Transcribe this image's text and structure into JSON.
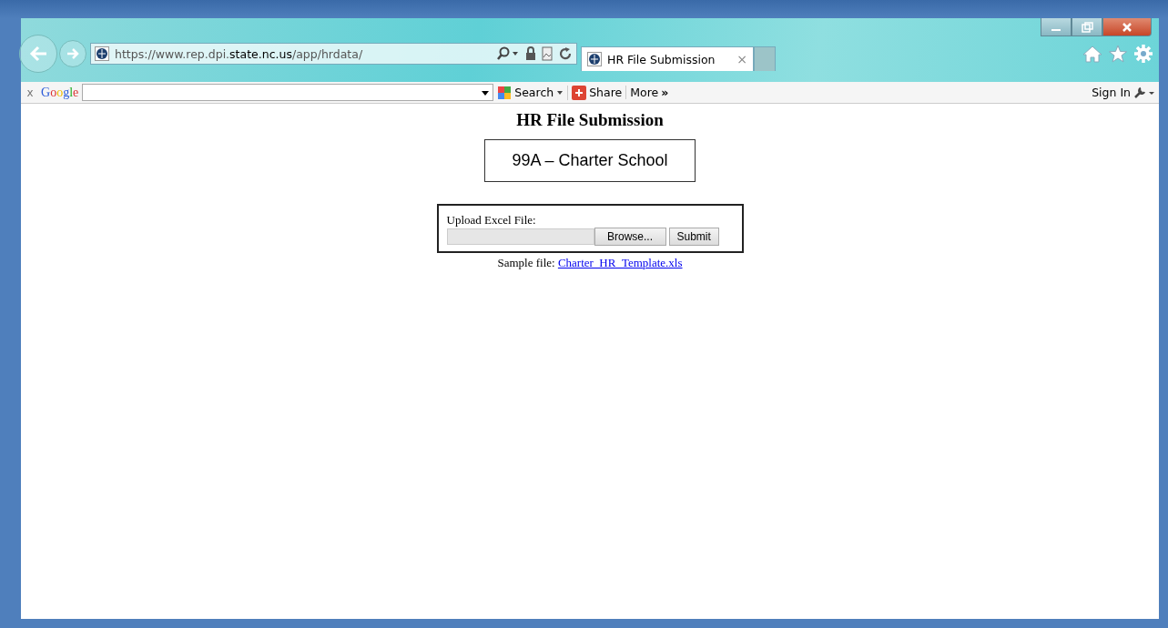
{
  "browser": {
    "address": "https://www.rep.dpi.**state.nc.us**/app/hrdata/",
    "tabs": [
      {
        "label": "HR File Submission",
        "close": "×",
        "selected": true
      },
      {
        "selected": false
      }
    ],
    "toolbar": {
      "close": "x",
      "logo": "Google",
      "search": "Search",
      "share": "Share",
      "more": "More",
      "more_glyph": "»",
      "sign_in": "Sign In"
    }
  },
  "page": {
    "title": "HR File Submission",
    "organization": "99A – Charter School",
    "upload": {
      "label": "Upload Excel File:",
      "browse": "Browse...",
      "submit": "Submit"
    },
    "sample": {
      "text": "Sample file:",
      "link": "Charter_HR_Template.xls"
    }
  }
}
